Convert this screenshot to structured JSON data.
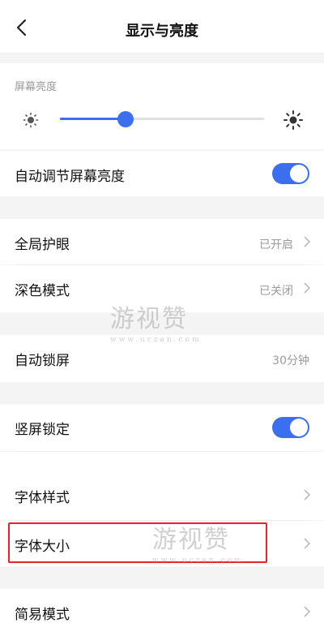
{
  "header": {
    "title": "显示与亮度"
  },
  "brightness": {
    "label": "屏幕亮度",
    "level_percent": 32
  },
  "rows": [
    {
      "label": "自动调节屏幕亮度",
      "toggle_on": true
    },
    {
      "label": "全局护眼",
      "value": "已开启"
    },
    {
      "label": "深色模式",
      "value": "已关闭"
    },
    {
      "label": "自动锁屏",
      "value": "30分钟"
    },
    {
      "label": "竖屏锁定",
      "toggle_on": true
    },
    {
      "label": "字体样式"
    },
    {
      "label": "字体大小"
    },
    {
      "label": "简易模式"
    }
  ],
  "watermark": {
    "text": "游视赞",
    "url": "www.uczan.com"
  },
  "colors": {
    "accent": "#3a6ff0",
    "highlight": "#e8222b"
  }
}
